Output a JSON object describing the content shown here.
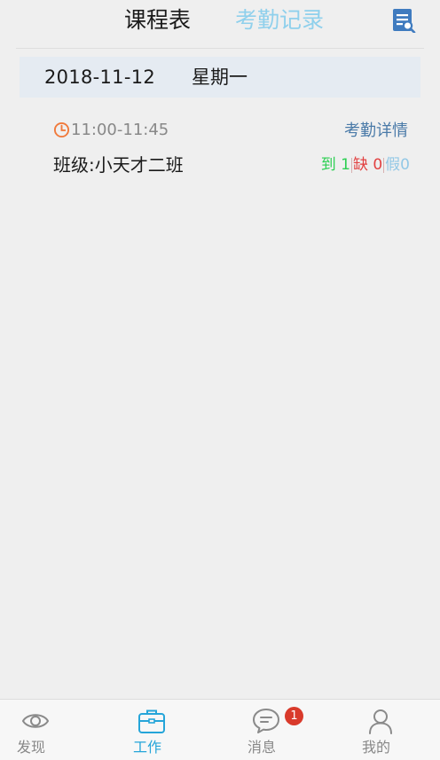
{
  "header": {
    "tabs": [
      {
        "label": "课程表",
        "active": true
      },
      {
        "label": "考勤记录",
        "active": false
      }
    ],
    "search_icon": "document-search-icon"
  },
  "date_bar": {
    "date": "2018-11-12",
    "weekday": "星期一"
  },
  "course": {
    "time": "11:00-11:45",
    "detail_label": "考勤详情",
    "class_name": "班级:小天才二班",
    "present": "到 1",
    "absent": "缺 0",
    "leave": "假0"
  },
  "bottom_nav": {
    "items": [
      {
        "label": "发现",
        "icon": "eye-icon",
        "active": false
      },
      {
        "label": "工作",
        "icon": "briefcase-icon",
        "active": true
      },
      {
        "label": "消息",
        "icon": "chat-icon",
        "active": false,
        "badge": "1"
      },
      {
        "label": "我的",
        "icon": "person-icon",
        "active": false
      }
    ]
  },
  "colors": {
    "active_tab": "#1a1a1a",
    "inactive_tab": "#8fd0ec",
    "accent": "#25a5d9",
    "present": "#2ccf52",
    "absent": "#e24141",
    "leave": "#93c8e6",
    "badge": "#d93a2b",
    "clock": "#f07a3c"
  }
}
